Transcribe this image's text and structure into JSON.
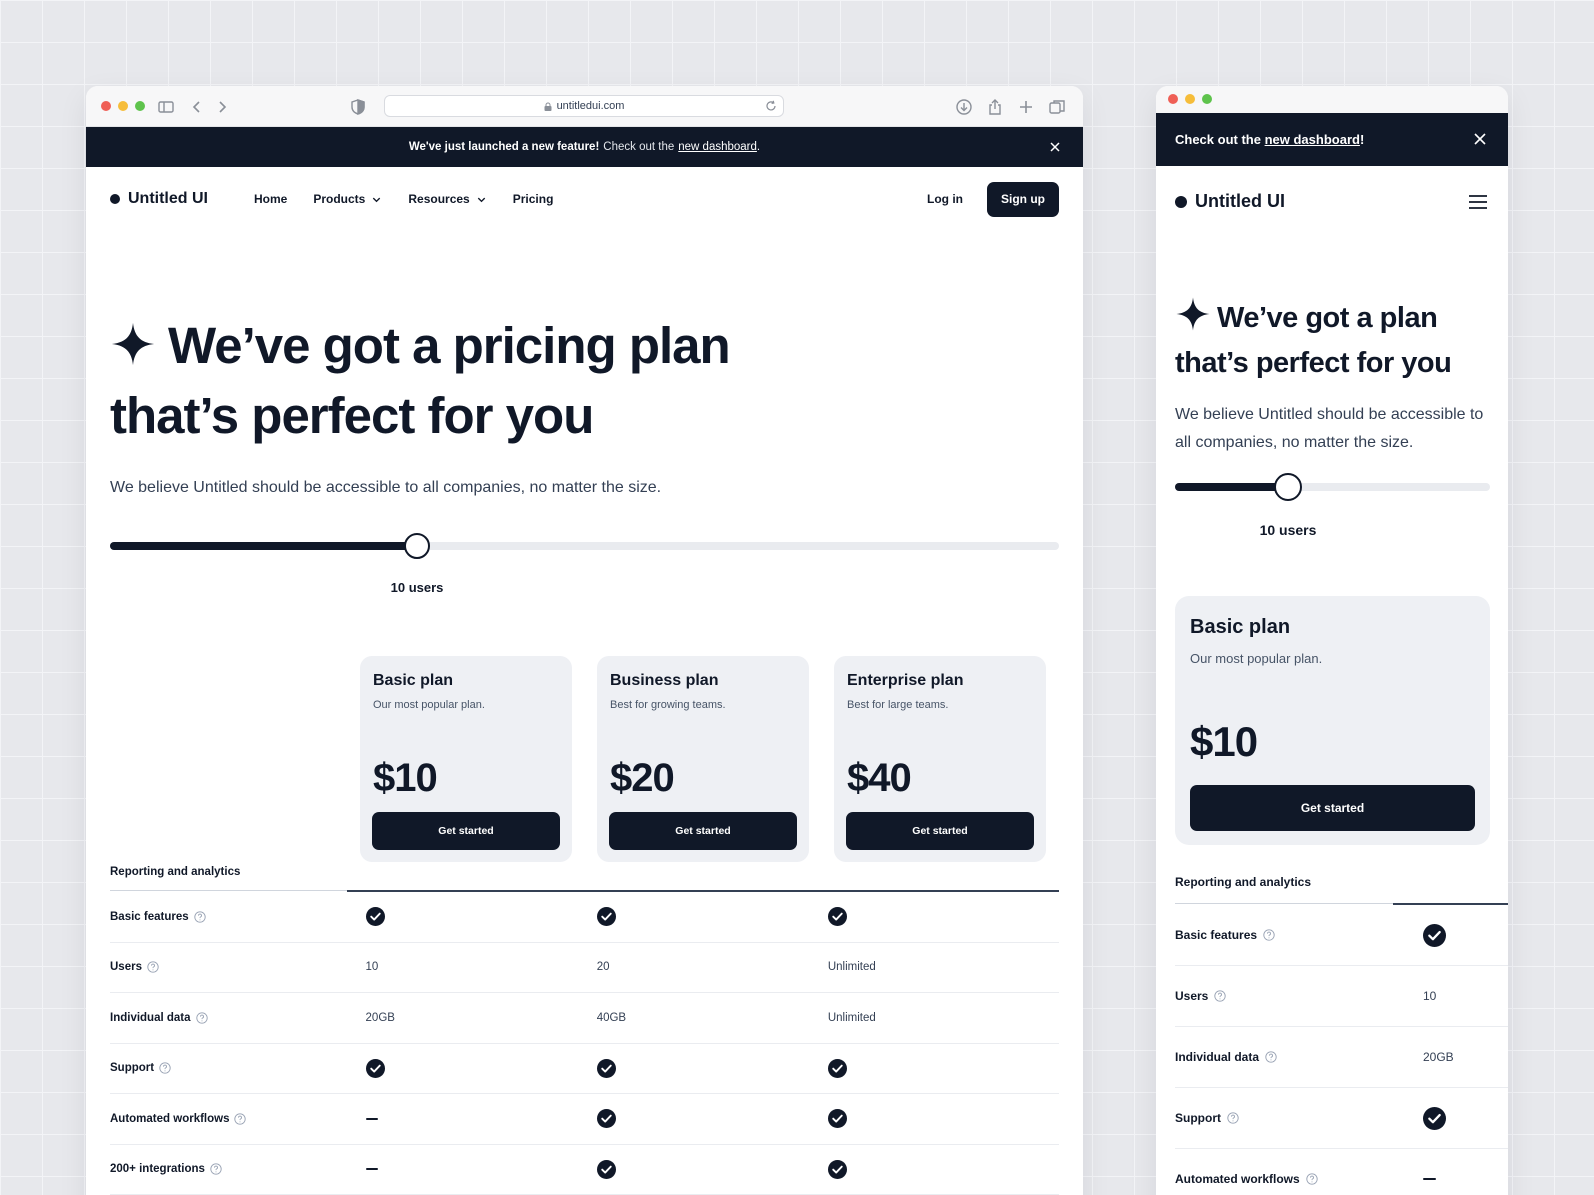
{
  "browser": {
    "url": "untitledui.com"
  },
  "banner": {
    "bold": "We've just launched a new feature!",
    "text": "Check out the",
    "link": "new dashboard",
    "suffix": "."
  },
  "brand": {
    "name": "Untitled UI"
  },
  "nav": {
    "home": "Home",
    "products": "Products",
    "resources": "Resources",
    "pricing": "Pricing",
    "login": "Log in",
    "signup": "Sign up"
  },
  "hero": {
    "title_line1": "We’ve got a pricing plan",
    "title_line2": "that’s perfect for you",
    "subtitle": "We believe Untitled should be accessible to all companies, no matter the size."
  },
  "slider": {
    "label": "10 users",
    "fraction": 0.324
  },
  "plans": [
    {
      "name": "Basic plan",
      "description": "Our most popular plan.",
      "price": "$10",
      "cta": "Get started"
    },
    {
      "name": "Business plan",
      "description": "Best for growing teams.",
      "price": "$20",
      "cta": "Get started"
    },
    {
      "name": "Enterprise plan",
      "description": "Best for large teams.",
      "price": "$40",
      "cta": "Get started"
    }
  ],
  "features": {
    "section_title": "Reporting and analytics",
    "rows": [
      {
        "name": "Basic features",
        "values": [
          "check",
          "check",
          "check"
        ]
      },
      {
        "name": "Users",
        "values": [
          "10",
          "20",
          "Unlimited"
        ]
      },
      {
        "name": "Individual data",
        "values": [
          "20GB",
          "40GB",
          "Unlimited"
        ]
      },
      {
        "name": "Support",
        "values": [
          "check",
          "check",
          "check"
        ]
      },
      {
        "name": "Automated workflows",
        "values": [
          "dash",
          "check",
          "check"
        ]
      },
      {
        "name": "200+ integrations",
        "values": [
          "dash",
          "check",
          "check"
        ]
      }
    ]
  },
  "mobile": {
    "banner_text": "Check out the",
    "banner_link": "new dashboard",
    "banner_suffix": "!",
    "title_line1": "We’ve got a plan",
    "title_line2": "that’s perfect for you",
    "subtitle": "We believe Untitled should be accessible to all companies, no matter the size.",
    "slider_label": "10 users",
    "slider_fraction": 0.36,
    "plan": {
      "name": "Basic plan",
      "description": "Our most popular plan.",
      "price": "$10",
      "cta": "Get started"
    },
    "section_title": "Reporting and analytics",
    "rows": [
      {
        "name": "Basic features",
        "value": "check"
      },
      {
        "name": "Users",
        "value": "10"
      },
      {
        "name": "Individual data",
        "value": "20GB"
      },
      {
        "name": "Support",
        "value": "check"
      },
      {
        "name": "Automated workflows",
        "value": "dash"
      }
    ]
  },
  "colors": {
    "ink": "#101828",
    "card": "#eef0f4",
    "track": "#e9ebef"
  }
}
